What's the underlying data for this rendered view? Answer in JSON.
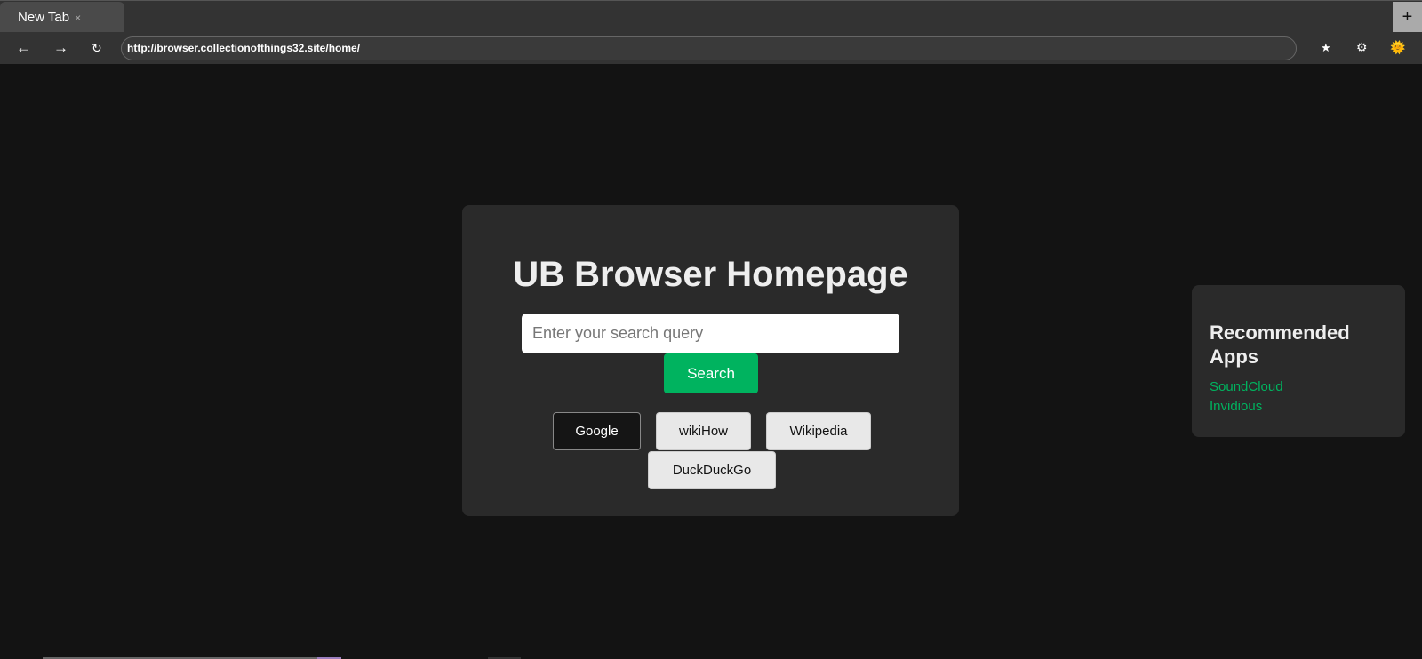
{
  "browser": {
    "tab_title": "New Tab",
    "tab_close": "×",
    "new_tab": "+",
    "back": "←",
    "forward": "→",
    "reload": "↻",
    "url": "http://browser.collectionofthings32.site/home/",
    "bookmark": "★",
    "settings": "⚙",
    "theme": "🌞"
  },
  "main": {
    "title": "UB Browser Homepage",
    "search_placeholder": "Enter your search query",
    "search_value": "",
    "search_button": "Search",
    "engines": [
      {
        "label": "Google",
        "selected": true
      },
      {
        "label": "wikiHow",
        "selected": false
      },
      {
        "label": "Wikipedia",
        "selected": false
      },
      {
        "label": "DuckDuckGo",
        "selected": false
      }
    ]
  },
  "recommended": {
    "title": "Recommended Apps",
    "apps": [
      "SoundCloud",
      "Invidious"
    ]
  },
  "colors": {
    "accent": "#00b35f",
    "background": "#131313",
    "card": "#2a2a2a"
  }
}
